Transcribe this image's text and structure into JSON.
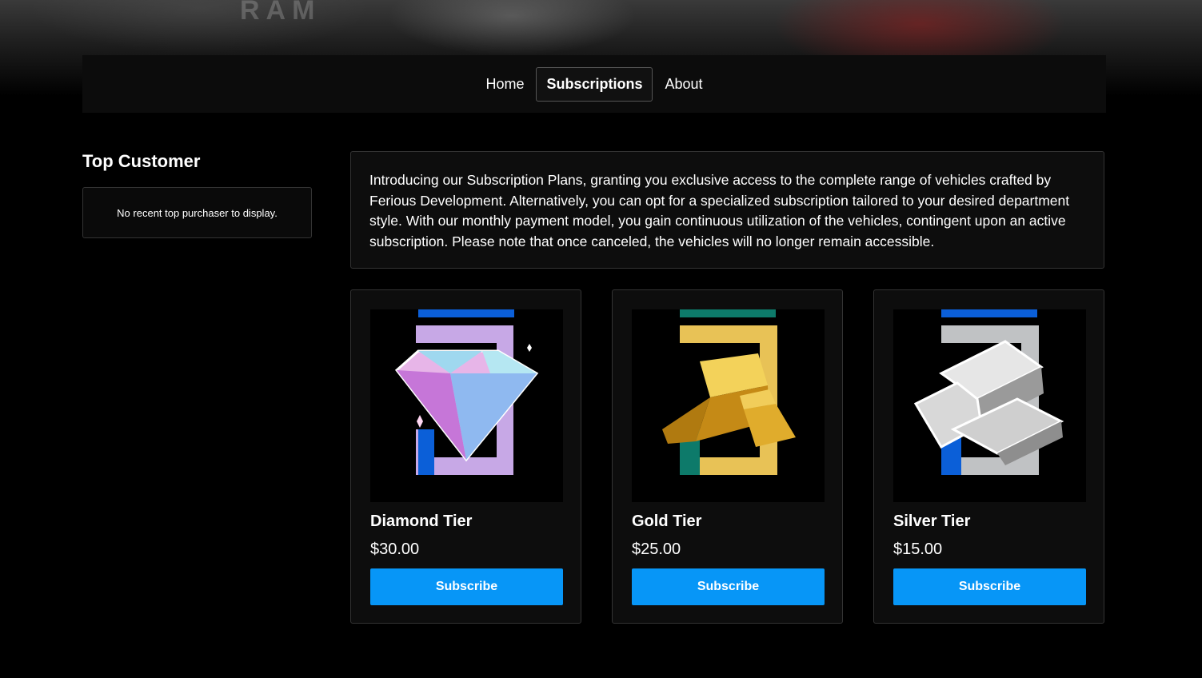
{
  "hero": {
    "brand_mark": "RAM"
  },
  "nav": {
    "items": [
      {
        "label": "Home"
      },
      {
        "label": "Subscriptions"
      },
      {
        "label": "About"
      }
    ]
  },
  "sidebar": {
    "title": "Top Customer",
    "empty_message": "No recent top purchaser to display."
  },
  "intro": {
    "text": "Introducing our Subscription Plans, granting you exclusive access to the complete range of vehicles crafted by Ferious Development. Alternatively, you can opt for a specialized subscription tailored to your desired department style. With our monthly payment model, you gain continuous utilization of the vehicles, contingent upon an active subscription. Please note that once canceled, the vehicles will no longer remain accessible."
  },
  "plans": [
    {
      "name": "Diamond Tier",
      "price": "$30.00",
      "button": "Subscribe",
      "icon": "diamond-icon",
      "accent": "#c7a8e6",
      "stripe": "#0b5fd8"
    },
    {
      "name": "Gold Tier",
      "price": "$25.00",
      "button": "Subscribe",
      "icon": "gold-bars-icon",
      "accent": "#e8c256",
      "stripe": "#0d7a6a"
    },
    {
      "name": "Silver Tier",
      "price": "$15.00",
      "button": "Subscribe",
      "icon": "silver-bars-icon",
      "accent": "#c0c2c4",
      "stripe": "#0b5fd8"
    }
  ]
}
